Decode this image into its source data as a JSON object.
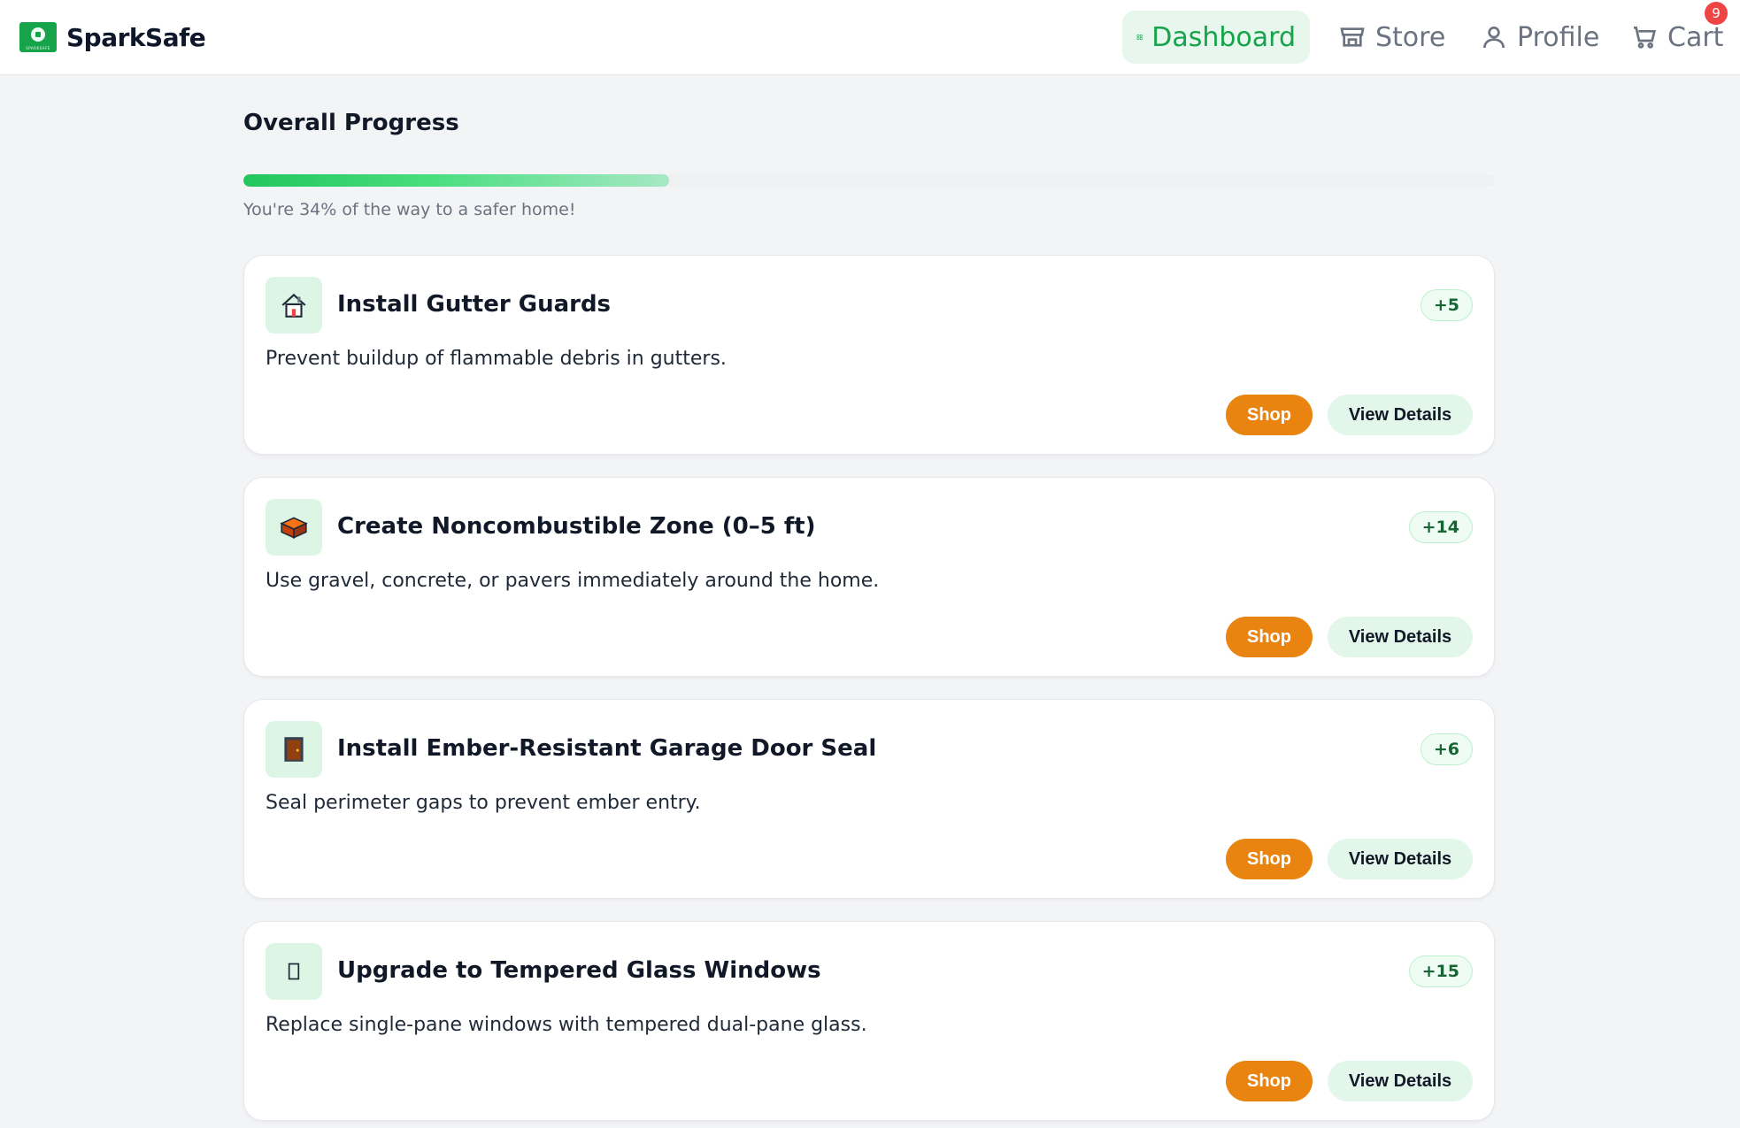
{
  "brand": {
    "name": "SparkSafe",
    "logo_text": "SPARKSAFE"
  },
  "nav": {
    "dashboard": "Dashboard",
    "store": "Store",
    "profile": "Profile",
    "cart": "Cart",
    "cart_count": "9"
  },
  "progress": {
    "title": "Overall Progress",
    "percent": 34,
    "caption": "You're 34% of the way to a safer home!"
  },
  "tasks": [
    {
      "icon": "house-icon",
      "title": "Install Gutter Guards",
      "points": "+5",
      "description": "Prevent buildup of flammable debris in gutters.",
      "shop": "Shop",
      "details": "View Details"
    },
    {
      "icon": "bricks-icon",
      "title": "Create Noncombustible Zone (0–5 ft)",
      "points": "+14",
      "description": "Use gravel, concrete, or pavers immediately around the home.",
      "shop": "Shop",
      "details": "View Details"
    },
    {
      "icon": "door-icon",
      "title": "Install Ember-Resistant Garage Door Seal",
      "points": "+6",
      "description": "Seal perimeter gaps to prevent ember entry.",
      "shop": "Shop",
      "details": "View Details"
    },
    {
      "icon": "window-icon",
      "title": "Upgrade to Tempered Glass Windows",
      "points": "+15",
      "description": "Replace single-pane windows with tempered dual-pane glass.",
      "shop": "Shop",
      "details": "View Details"
    }
  ],
  "colors": {
    "brand_green": "#16a34a",
    "shop_orange": "#e8840f",
    "badge_red": "#ef4444"
  }
}
